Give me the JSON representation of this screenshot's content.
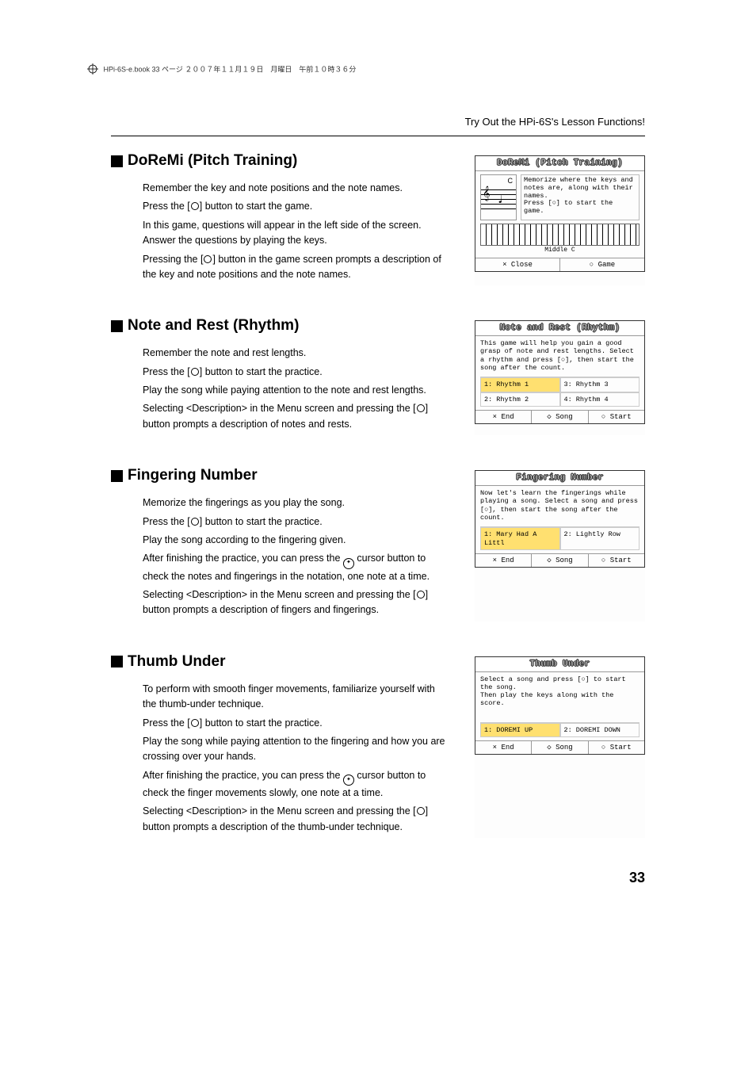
{
  "header_line": "HPi-6S-e.book  33 ページ  ２００７年１１月１９日　月曜日　午前１０時３６分",
  "breadcrumb": "Try Out the HPi-6S's Lesson Functions!",
  "page_number": "33",
  "sections": {
    "doremi": {
      "title": "DoReMi (Pitch Training)",
      "p1": "Remember the key and note positions and the note names.",
      "p2a": "Press the [",
      "p2b": "] button to start the game.",
      "p3": "In this game, questions will appear in the left side of the screen. Answer the questions by playing the keys.",
      "p4a": "Pressing the [",
      "p4b": "] button in the game screen prompts a description of the key and note positions and the note names.",
      "lcd": {
        "title": "DoReMi (Pitch Training)",
        "body": "Memorize where the keys and notes are, along with their names.\nPress [○] to start the game.",
        "note_label": "C",
        "middle_c": "Middle C",
        "footer_left": "× Close",
        "footer_right": "○ Game"
      }
    },
    "rhythm": {
      "title": "Note and Rest (Rhythm)",
      "p1": "Remember the note and rest lengths.",
      "p2a": "Press the [",
      "p2b": "] button to start the practice.",
      "p3": "Play the song while paying attention to the note and rest lengths.",
      "p4a": "Selecting <Description> in the Menu screen and pressing the [",
      "p4b": "] button prompts a description of notes and rests.",
      "lcd": {
        "title": "Note and Rest (Rhythm)",
        "body": "This game will help you gain a good grasp of note and rest lengths. Select a rhythm and press [○], then start the song after the count.",
        "opt1": "1: Rhythm  1",
        "opt2": "3: Rhythm  3",
        "opt3": "2: Rhythm  2",
        "opt4": "4: Rhythm  4",
        "footer_left": "× End",
        "footer_mid": "◇ Song",
        "footer_right": "○ Start"
      }
    },
    "fingering": {
      "title": "Fingering Number",
      "p1": "Memorize the fingerings as you play the song.",
      "p2a": "Press the [",
      "p2b": "] button to start the practice.",
      "p3": "Play the song according to the fingering given.",
      "p4a": "After finishing the practice, you can press the ",
      "p4b": " cursor button to check the notes and fingerings in the notation, one note at a time.",
      "p5a": "Selecting <Description> in the Menu screen and pressing the [",
      "p5b": "] button prompts a description of fingers and fingerings.",
      "lcd": {
        "title": "Fingering Number",
        "body": "Now let's learn the fingerings while playing a song. Select a song and press [○], then start the song after the count.",
        "opt1": "1: Mary Had A Littl",
        "opt2": "2: Lightly Row",
        "footer_left": "× End",
        "footer_mid": "◇ Song",
        "footer_right": "○ Start"
      }
    },
    "thumb": {
      "title": "Thumb Under",
      "p1": "To perform with smooth finger movements, familiarize yourself with the thumb-under technique.",
      "p2a": "Press the [",
      "p2b": "] button to start the practice.",
      "p3": "Play the song while paying attention to the fingering and how you are crossing over your hands.",
      "p4a": "After finishing the practice, you can press the ",
      "p4b": " cursor button to check the finger movements slowly, one note at a time.",
      "p5a": "Selecting <Description> in the Menu screen and pressing the [",
      "p5b": "] button prompts a description of the thumb-under technique.",
      "lcd": {
        "title": "Thumb Under",
        "body": "Select a song and press [○] to start the song.\nThen play the keys along with the score.",
        "opt1": "1: DOREMI UP",
        "opt2": "2: DOREMI DOWN",
        "footer_left": "× End",
        "footer_mid": "◇ Song",
        "footer_right": "○ Start"
      }
    }
  }
}
